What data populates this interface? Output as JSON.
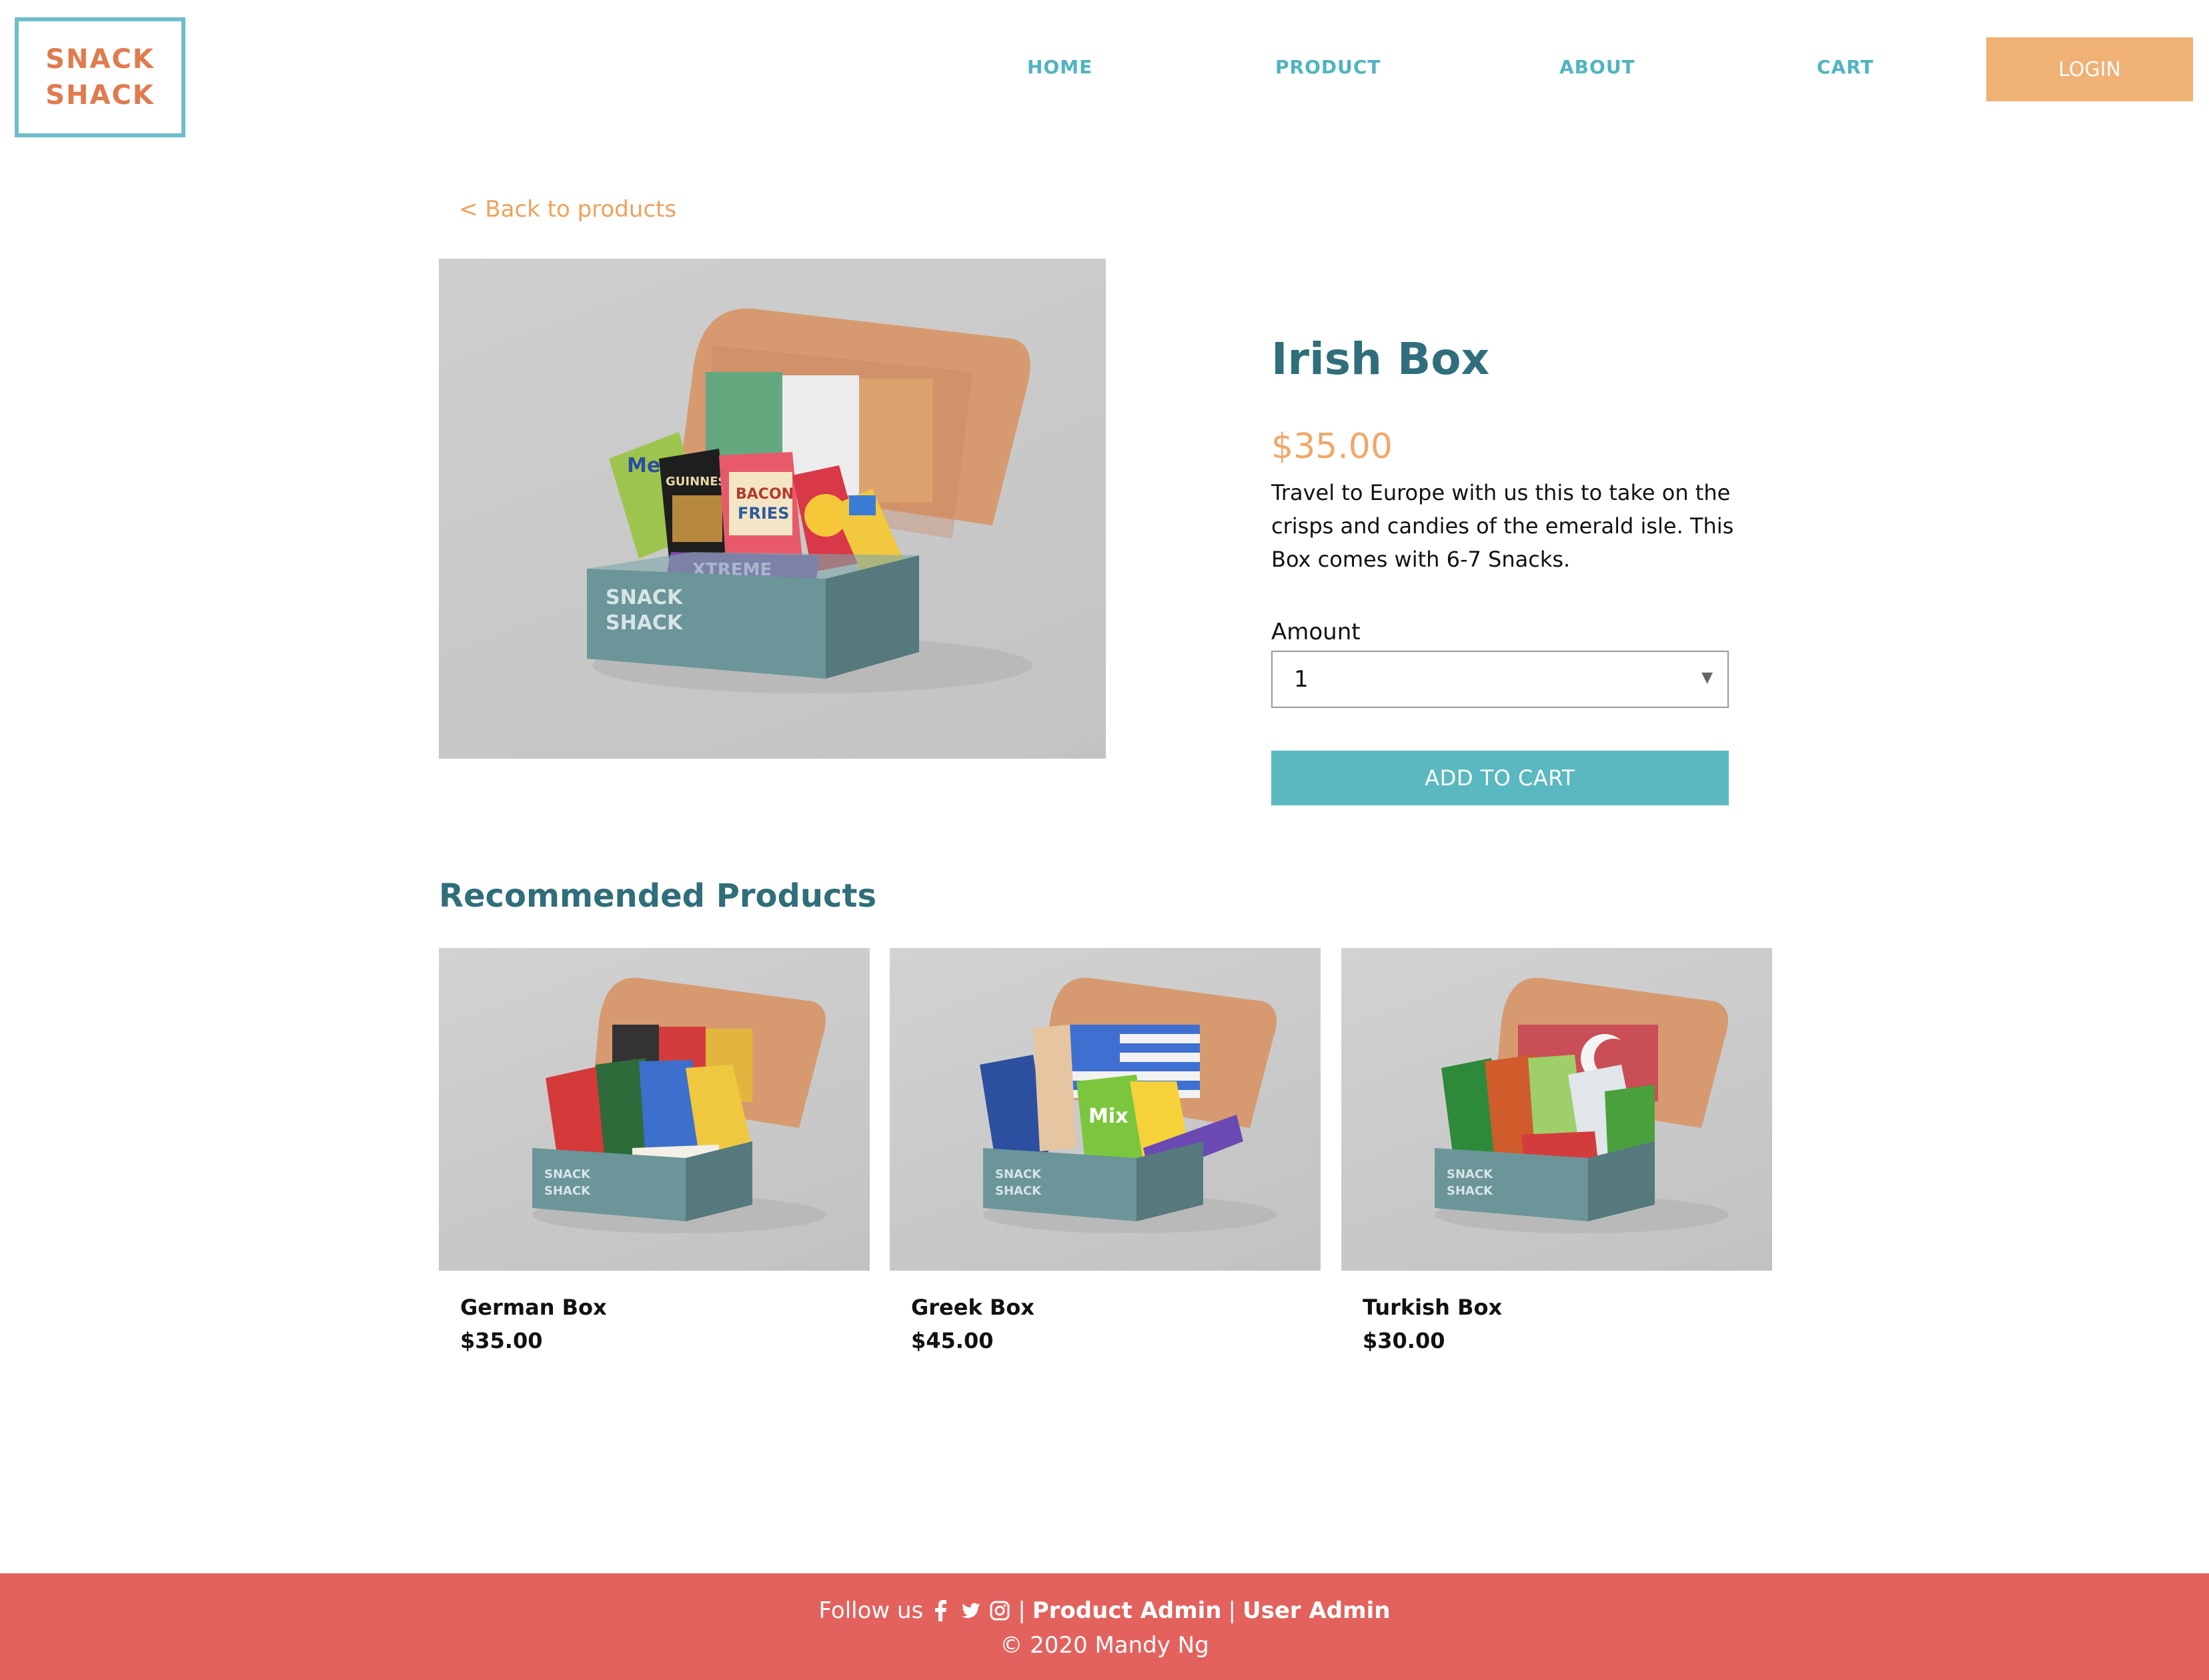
{
  "brand": {
    "line1": "SNACK",
    "line2": "SHACK"
  },
  "nav": {
    "home": "HOME",
    "product": "PRODUCT",
    "about": "ABOUT",
    "cart": "CART",
    "login": "LOGIN"
  },
  "product": {
    "back_label": "< Back to products",
    "title": "Irish Box",
    "price": "$35.00",
    "description": "Travel to Europe with us this to take on the crisps and candies of the emerald isle. This Box comes with 6-7 Snacks.",
    "amount_label": "Amount",
    "amount_value": "1",
    "add_to_cart_label": "ADD TO CART",
    "box_brand_line1": "SNACK",
    "box_brand_line2": "SHACK"
  },
  "recommended": {
    "title": "Recommended Products",
    "items": [
      {
        "name": "German Box",
        "price": "$35.00"
      },
      {
        "name": "Greek Box",
        "price": "$45.00"
      },
      {
        "name": "Turkish Box",
        "price": "$30.00"
      }
    ]
  },
  "footer": {
    "follow_label": "Follow us",
    "separator": "|",
    "product_admin": "Product Admin",
    "user_admin": "User Admin",
    "copyright": "© 2020 Mandy Ng"
  },
  "icons": [
    "facebook-icon",
    "twitter-icon",
    "instagram-icon"
  ],
  "colors": {
    "accent_teal": "#4fb4c0",
    "heading_teal": "#2f6e7a",
    "login_orange": "#f0b175",
    "price_orange": "#f0a868",
    "footer_red": "#e3625d",
    "button_teal": "#5ab8c0"
  }
}
